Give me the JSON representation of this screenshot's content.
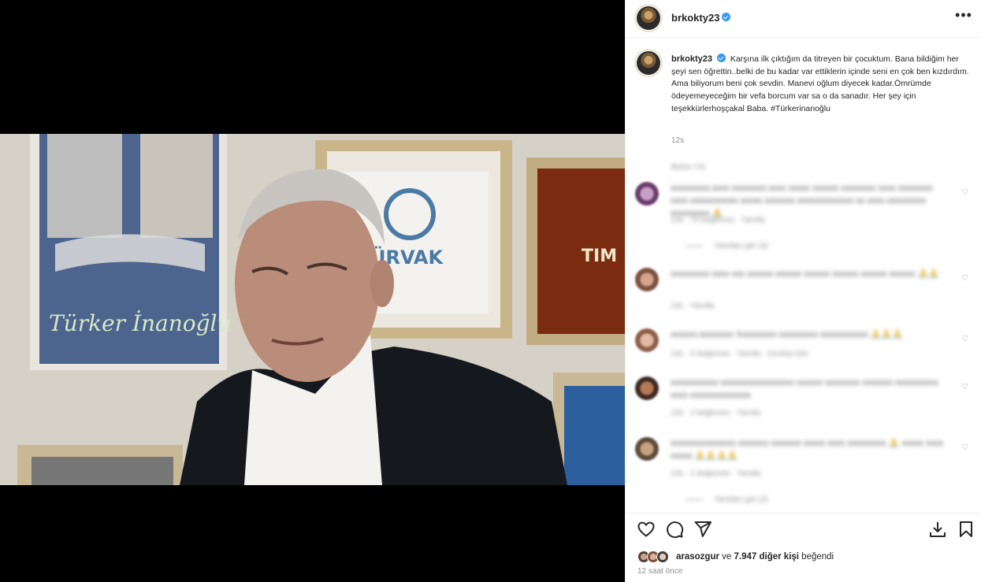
{
  "post": {
    "username": "brkokty23",
    "more_label": "•••"
  },
  "media": {
    "poster_text": "Türker İnanoğlu",
    "plaque_text": "ÜRVAK",
    "award_text": "TIM"
  },
  "caption": {
    "username": "brkokty23",
    "text": "Karşına ilk çıktığım da titreyen bir çocuktum. Bana bildiğim her şeyi sen öğrettin..belki de bu kadar var ettiklerin içinde seni en çok ben kızdırdım. Ama biliyorum beni çok sevdin. Manevi oğlum diyecek kadar.Ömrümde ödeyemeyeceğim bir vefa borcum var sa o da sanadır. Her şey için teşekkürlerhoşçakal Baba. #Türkerinanoğlu",
    "time": "12s"
  },
  "comments_header": "Bütün Yılı",
  "comments": [
    {
      "text": "xxxxxxxxx.xxxx xxxxxxxx xxxx xxxxx xxxxxx xxxxxxxx xxxx xxxxxxxx xxxx xxxxxxxxxxx xxxxx xxxxxxx xxxxxxxxxxxxx xx xxxx xxxxxxxxx xxxxxxxxx 🙏",
      "meta": "13s · 76 beğenme · Yanıtla",
      "replies": "Yanıtları gör (4)"
    },
    {
      "text": "xxxxxxxxx xxxx xxx xxxxxx xxxxxx xxxxxx xxxxxx xxxxxx xxxxxx 🙏🙏",
      "meta": "13s · Yanıtla",
      "replies": ""
    },
    {
      "text": "xxxxxx.xxxxxxxx Xxxxxxxxx xxxxxxxxx xxxxxxxxxxx 🙏🙏🙏",
      "meta": "13s · 5 beğenme · Yanıtla · Çeviriyi Gör",
      "replies": ""
    },
    {
      "text": "xxxxxxxxxxx xxxxxxxxxxxxxxxxx xxxxxx xxxxxxxx xxxxxxx xxxxxxxxxx xxxx xxxxxxxxxxxxxx",
      "meta": "13s · 2 beğenme · Yanıtla",
      "replies": ""
    },
    {
      "text": "xxxxxxxxxxxxxxx xxxxxxx xxxxxxx xxxxx xxxx xxxxxxxxx 🙏 xxxxx xxxx xxxxx 🙏🙏🙏🙏",
      "meta": "13s · 1 beğenme · Yanıtla",
      "replies": "Yanıtları gör (2)"
    }
  ],
  "likes": {
    "liker": "arasozgur",
    "connector": " ve ",
    "count": "7.947 diğer kişi",
    "suffix": " beğendi"
  },
  "post_time": "12 saat önce",
  "colors": {
    "verified": "#3897f0",
    "secondary_text": "#8e8e8e",
    "primary_text": "#262626"
  }
}
